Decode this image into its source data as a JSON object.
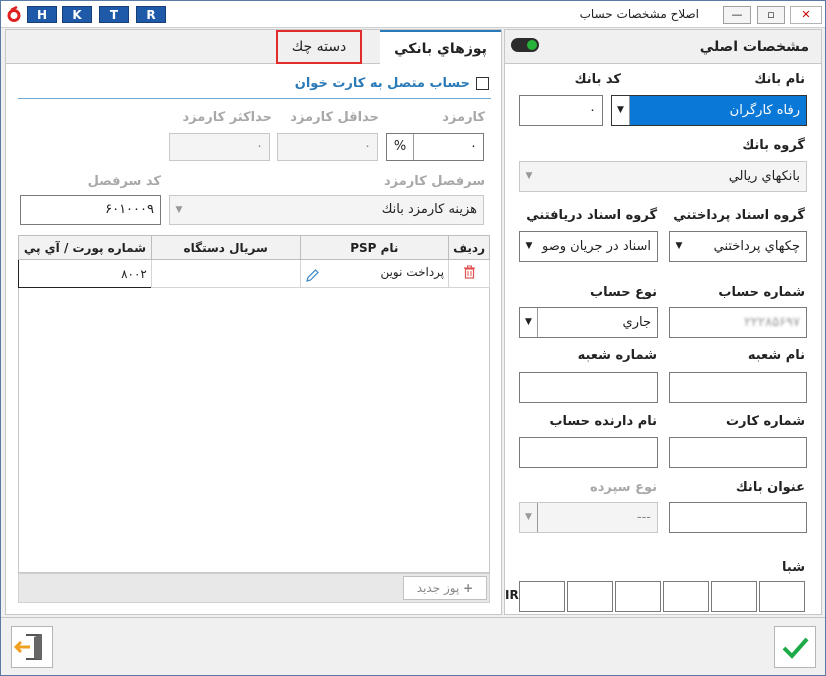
{
  "window": {
    "title": "اصلاح مشخصات حساب",
    "hotkeys": [
      "H",
      "K",
      "T",
      "R"
    ],
    "minimize_glyph": "—",
    "restore_glyph": "▫",
    "close_glyph": "✕"
  },
  "main_panel": {
    "title": "مشخصات اصلي",
    "bank_name_label": "نام بانك",
    "bank_name_value": "رفاه كارگران",
    "bank_code_label": "كد بانك",
    "bank_code_value": "۰",
    "bank_group_label": "گروه بانك",
    "bank_group_value": "بانكهاي ريالي",
    "pay_doc_group_label": "گروه اسناد پرداختني",
    "pay_doc_group_value": "چكهاي پرداختني",
    "recv_doc_group_label": "گروه اسناد دريافتني",
    "recv_doc_group_value": "اسناد در جريان وصو",
    "account_number_label": "شماره حساب",
    "account_number_value": "۲۲۲۸۵۶۹۷",
    "account_type_label": "نوع حساب",
    "account_type_value": "جاري",
    "branch_name_label": "نام شعبه",
    "branch_name_value": "",
    "branch_number_label": "شماره شعبه",
    "branch_number_value": "",
    "card_number_label": "شماره كارت",
    "card_number_value": "",
    "holder_name_label": "نام دارنده حساب",
    "holder_name_value": "",
    "bank_title_label": "عنوان بانك",
    "bank_title_value": "",
    "deposit_type_label": "نوع سپرده",
    "deposit_type_value": "---",
    "sheba_label": "شبا",
    "sheba_prefix": "IR"
  },
  "tabs": [
    {
      "label": "پوزهاي بانكي"
    },
    {
      "label": "دسته چك"
    }
  ],
  "pos_panel": {
    "card_reader_label": "حساب متصل به كارت خوان",
    "fee_label": "كارمزد",
    "fee_value": "۰",
    "fee_unit": "%",
    "min_fee_label": "حداقل كارمزد",
    "min_fee_value": "۰",
    "max_fee_label": "حداكثر كارمزد",
    "max_fee_value": "۰",
    "fee_ledger_label": "سرفصل كارمزد",
    "fee_ledger_value": "هزينه كارمزد بانك",
    "ledger_code_label": "كد سرفصل",
    "ledger_code_value": "۶۰۱۰۰۰۹",
    "table_headers": [
      "رديف",
      "نام PSP",
      "سريال دستگاه",
      "شماره پورت / آي پي"
    ],
    "rows": [
      {
        "psp": "پرداخت نوين",
        "serial": "",
        "port": "۸۰۰۲"
      }
    ],
    "add_pos_label": "پوز جديد"
  }
}
